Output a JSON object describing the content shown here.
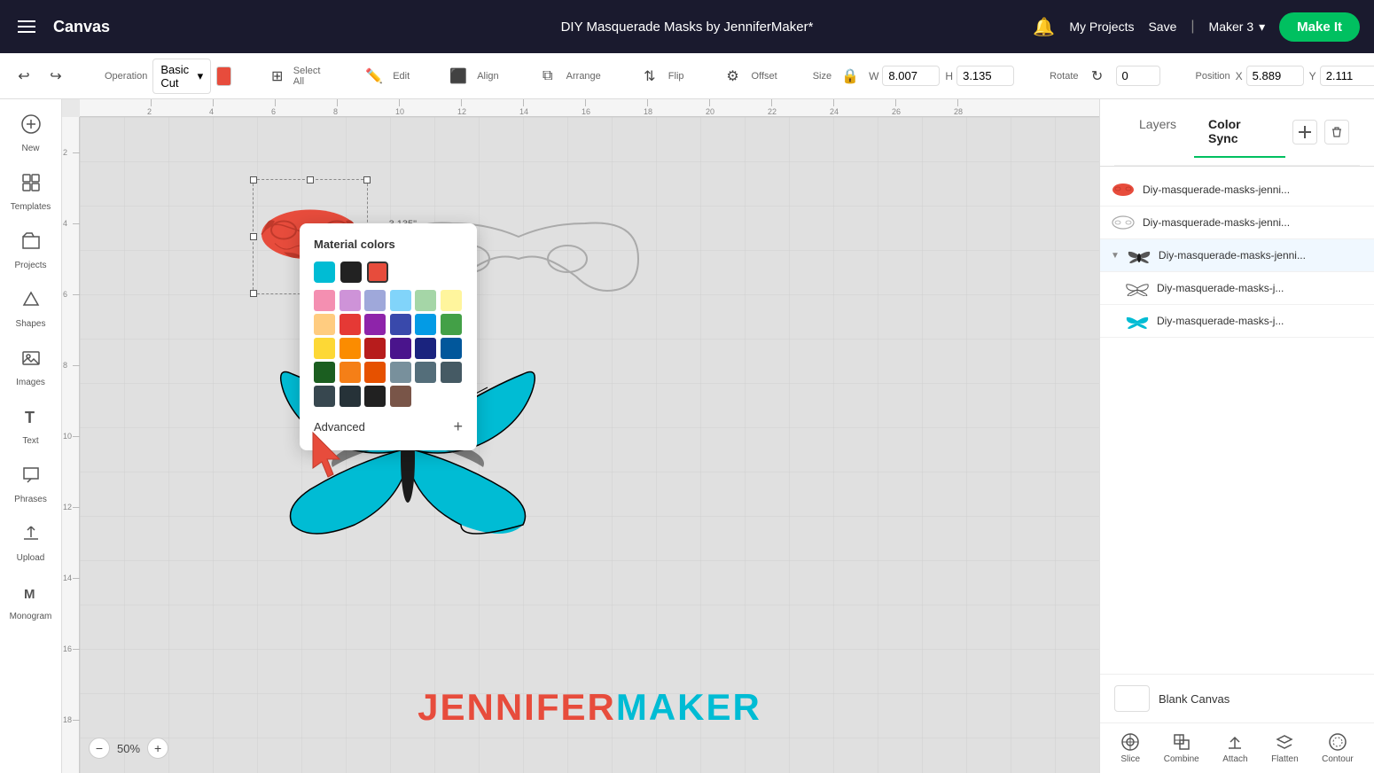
{
  "app": {
    "title": "Canvas",
    "document_title": "DIY Masquerade Masks by JenniferMaker*",
    "make_it_label": "Make It",
    "my_projects_label": "My Projects",
    "save_label": "Save",
    "maker_label": "Maker 3"
  },
  "toolbar": {
    "operation_label": "Operation",
    "operation_value": "Basic Cut",
    "select_all_label": "Select All",
    "edit_label": "Edit",
    "align_label": "Align",
    "arrange_label": "Arrange",
    "flip_label": "Flip",
    "offset_label": "Offset",
    "size_label": "Size",
    "rotate_label": "Rotate",
    "position_label": "Position",
    "size_w": "8.007",
    "size_h": "3.135",
    "rotate_val": "0",
    "position_x": "5.889",
    "position_y": "2.111",
    "w_label": "W",
    "h_label": "H",
    "x_label": "X",
    "y_label": "Y"
  },
  "sidebar": {
    "items": [
      {
        "id": "new",
        "label": "New",
        "icon": "+"
      },
      {
        "id": "templates",
        "label": "Templates",
        "icon": "⊞"
      },
      {
        "id": "projects",
        "label": "Projects",
        "icon": "📁"
      },
      {
        "id": "shapes",
        "label": "Shapes",
        "icon": "◇"
      },
      {
        "id": "images",
        "label": "Images",
        "icon": "🖼"
      },
      {
        "id": "text",
        "label": "Text",
        "icon": "T"
      },
      {
        "id": "phrases",
        "label": "Phrases",
        "icon": "💬"
      },
      {
        "id": "upload",
        "label": "Upload",
        "icon": "⬆"
      },
      {
        "id": "monogram",
        "label": "Monogram",
        "icon": "M"
      }
    ]
  },
  "right_panel": {
    "tabs": [
      {
        "id": "layers",
        "label": "Layers",
        "active": false
      },
      {
        "id": "color_sync",
        "label": "Color Sync",
        "active": true
      }
    ],
    "layers": [
      {
        "id": 1,
        "name": "Diy-masquerade-masks-jenni...",
        "color": "#e74c3c",
        "type": "mask",
        "expanded": false,
        "icon": "mask-red"
      },
      {
        "id": 2,
        "name": "Diy-masquerade-masks-jenni...",
        "color": "#888",
        "type": "mask",
        "expanded": false,
        "icon": "mask-outline"
      },
      {
        "id": 3,
        "name": "Diy-masquerade-masks-jenni...",
        "color": "#333",
        "type": "butterfly",
        "expanded": true,
        "icon": "butterfly-dark"
      },
      {
        "id": 4,
        "name": "Diy-masquerade-masks-j...",
        "color": "#333",
        "type": "butterfly",
        "expanded": false,
        "icon": "butterfly-outline"
      },
      {
        "id": 5,
        "name": "Diy-masquerade-masks-j...",
        "color": "#00bcd4",
        "type": "butterfly",
        "expanded": false,
        "icon": "butterfly-teal"
      }
    ],
    "blank_canvas_label": "Blank Canvas",
    "add_icon": "+",
    "delete_icon": "🗑"
  },
  "bottom_tools": [
    {
      "id": "slice",
      "label": "Slice"
    },
    {
      "id": "combine",
      "label": "Combine"
    },
    {
      "id": "attach",
      "label": "Attach"
    },
    {
      "id": "flatten",
      "label": "Flatten"
    },
    {
      "id": "contour",
      "label": "Contour"
    }
  ],
  "color_picker": {
    "title": "Material colors",
    "top_colors": [
      "#00bcd4",
      "#222222",
      "#e74c3c"
    ],
    "grid_colors": [
      "#f48fb1",
      "#ce93d8",
      "#9fa8da",
      "#81d4fa",
      "#a5d6a7",
      "#fff59d",
      "#ffcc80",
      "#e53935",
      "#8e24aa",
      "#3949ab",
      "#039be5",
      "#43a047",
      "#fdd835",
      "#fb8c00",
      "#b71c1c",
      "#4a148c",
      "#1a237e",
      "#01579b",
      "#1b5e20",
      "#f57f17",
      "#e65100",
      "#78909c",
      "#546e7a",
      "#455a64",
      "#37474f",
      "#263238",
      "#212121",
      "#795548"
    ],
    "advanced_label": "Advanced",
    "add_label": "+"
  },
  "zoom": {
    "level": "50%"
  },
  "canvas": {
    "selection_label": "3.135\""
  },
  "ruler": {
    "h_marks": [
      2,
      4,
      6,
      8,
      10,
      12,
      14,
      16,
      18,
      20,
      22,
      24,
      26,
      28
    ],
    "v_marks": [
      2,
      4,
      6,
      8,
      10,
      12,
      14,
      16,
      18
    ]
  }
}
